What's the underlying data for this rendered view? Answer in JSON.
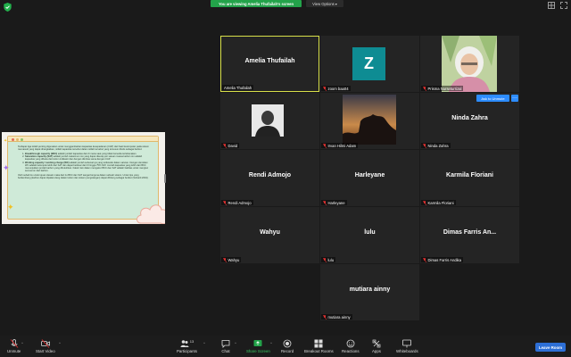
{
  "top": {
    "viewing_banner": "You are viewing Amelia Thufailah's screen",
    "view_options": "View Options",
    "view_options_caret": "▾"
  },
  "shared_doc": {
    "intro": "Terdapat tiga istilah penting digunakan untuk menggambarkan kapasitas kesepadanan (CAP) dari hasil kesimpulan pada sistem memasuki yang dapat dirangkaikan, istilah kapasitas tersebut dalam istilah tersebut yang tersusun ditulis sebagai berikut:",
    "items": [
      {
        "title": "Breakthrough capacity (BKC)",
        "text": "adalah jumlah kapasitas dari di mana saat yang tidak bersedia tertahanakan."
      },
      {
        "title": "Saturation capacity (SAT)",
        "text": "adalah jumlah maksimum ion yang dapat diserap per satuan massa karbon ion adalah kapasitas yang dibuka dari kolom indikator dan dengan diimbas sama dengan CAP."
      },
      {
        "title": "Working capacity / working charge (WC)",
        "text": "adalah jumlah sebenarnya yang terdeteksi dalam saluran. Dengan demikian WC adalah kelompok lebih dari SAT dan dapat berkisar dari 0 hingga 75% SAT. Jumlah kapasitas yang lebih dari BKC menunjukkan jumlah karbon yang dibutuhkan. Faktor lain dalam mengukur BKC dan SAT adalah fasilitas untuk mengkur semua ion dari karbon."
      }
    ],
    "outro": "Oleh sebab itu untuk tujuan desain maka dari itu BKC dan SAT sangat berguna dalam sebuah sistem. Untuk tipe yang berkembang (karbon dapat dipakai ulang dalam kolom dan sistem pengulangan) dapat dihitung sebagai berikut (Suhardi 2004)."
  },
  "tiles": [
    {
      "name": "Amelia Thufailah",
      "caption": "Amelia Thufailah",
      "muted": false
    },
    {
      "name": "",
      "caption": "zoom baa04",
      "muted": true,
      "avatar_letter": "Z"
    },
    {
      "name": "",
      "caption": "Prisma Nurseturrizal",
      "muted": true
    },
    {
      "name": "",
      "caption": "David",
      "muted": true
    },
    {
      "name": "",
      "caption": "Irvan Hilmi Adam",
      "muted": true
    },
    {
      "name": "Ninda Zahra",
      "caption": "Ninda Zahra",
      "muted": true
    },
    {
      "name": "Rendi Admojo",
      "caption": "Rendi Admojo",
      "muted": true
    },
    {
      "name": "Harleyane",
      "caption": "Harleyane",
      "muted": true
    },
    {
      "name": "Karmila Floriani",
      "caption": "Karmila Floriani",
      "muted": true
    },
    {
      "name": "Wahyu",
      "caption": "Wahyu",
      "muted": true
    },
    {
      "name": "lulu",
      "caption": "lulu",
      "muted": true
    },
    {
      "name": "Dimas Farris An...",
      "caption": "Dimas Farris Andika",
      "muted": true
    },
    {
      "name": "mutiara ainny",
      "caption": "mutiara ainny",
      "muted": true
    }
  ],
  "ask_to_unmute": "Ask to Unmute",
  "more": "···",
  "toolbar": {
    "unmute": "Unmute",
    "start_video": "Start Video",
    "participants": "Participants",
    "participants_count": "13",
    "chat": "Chat",
    "share_screen": "Share Screen",
    "record": "Record",
    "breakout_rooms": "Breakout Rooms",
    "reactions": "Reactions",
    "apps": "Apps",
    "whiteboards": "Whiteboards",
    "leave_room": "Leave Room"
  },
  "colors": {
    "banner_green": "#23a34a",
    "tile_bg": "#242424",
    "active_border": "#d8e04a",
    "avatar_teal": "#0e8c93",
    "accent_blue": "#2d8cff",
    "muted_red": "#e03030"
  }
}
